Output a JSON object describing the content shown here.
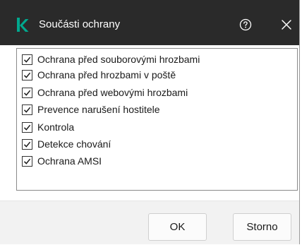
{
  "window": {
    "title": "Součásti ochrany",
    "help_icon": "help-circle-icon",
    "close_icon": "close-icon",
    "logo_icon": "kaspersky-k-logo",
    "colors": {
      "titlebar_bg": "#2a2a2a",
      "logo_green": "#00a88e",
      "footer_bg": "#f2f2f2"
    }
  },
  "components": [
    {
      "label": "Ochrana před souborovými hrozbami",
      "checked": true
    },
    {
      "label": "Ochrana před hrozbami v poště",
      "checked": true
    },
    {
      "label": "Ochrana před webovými hrozbami",
      "checked": true
    },
    {
      "label": "Prevence narušení hostitele",
      "checked": true
    },
    {
      "label": "Kontrola",
      "checked": true
    },
    {
      "label": "Detekce chování",
      "checked": true
    },
    {
      "label": "Ochrana AMSI",
      "checked": true
    }
  ],
  "footer": {
    "ok_label": "OK",
    "cancel_label": "Storno"
  }
}
